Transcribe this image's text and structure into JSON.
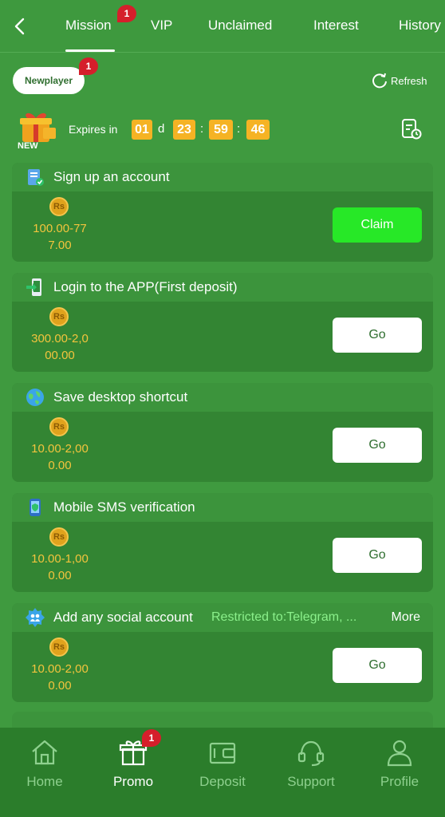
{
  "topnav": {
    "tabs": [
      {
        "label": "Mission",
        "badge": "1",
        "active": true
      },
      {
        "label": "VIP"
      },
      {
        "label": "Unclaimed"
      },
      {
        "label": "Interest"
      },
      {
        "label": "History"
      }
    ]
  },
  "subbar": {
    "pill_label": "Newplayer",
    "pill_badge": "1",
    "refresh_label": "Refresh"
  },
  "expires": {
    "gift_label": "NEW",
    "label": "Expires in",
    "days": "01",
    "days_unit": "d",
    "hours": "23",
    "minutes": "59",
    "seconds": "46",
    "sep": ":"
  },
  "missions": [
    {
      "title": "Sign up an account",
      "coin": "Rs",
      "reward_line1": "100.00-77",
      "reward_line2": "7.00",
      "button": "Claim",
      "icon": "clipboard-check-icon"
    },
    {
      "title": "Login to the APP(First deposit)",
      "coin": "Rs",
      "reward_line1": "300.00-2,0",
      "reward_line2": "00.00",
      "button": "Go",
      "icon": "phone-login-icon"
    },
    {
      "title": "Save desktop shortcut",
      "coin": "Rs",
      "reward_line1": "10.00-2,00",
      "reward_line2": "0.00",
      "button": "Go",
      "icon": "globe-icon"
    },
    {
      "title": "Mobile SMS verification",
      "coin": "Rs",
      "reward_line1": "10.00-1,00",
      "reward_line2": "0.00",
      "button": "Go",
      "icon": "phone-shield-icon"
    },
    {
      "title": "Add any social account",
      "restricted": "Restricted to:Telegram, ...",
      "more": "More",
      "coin": "Rs",
      "reward_line1": "10.00-2,00",
      "reward_line2": "0.00",
      "button": "Go",
      "icon": "social-icon"
    }
  ],
  "bottomnav": {
    "items": [
      {
        "label": "Home",
        "icon": "home-icon"
      },
      {
        "label": "Promo",
        "icon": "gift-icon",
        "badge": "1",
        "active": true
      },
      {
        "label": "Deposit",
        "icon": "wallet-icon"
      },
      {
        "label": "Support",
        "icon": "headset-icon"
      },
      {
        "label": "Profile",
        "icon": "user-icon"
      }
    ]
  },
  "colors": {
    "background": "#3f9a3f",
    "card": "#338533",
    "accent_gold": "#f3c43d",
    "timer": "#f5b324",
    "claim": "#27e827",
    "badge": "#d51f2b"
  }
}
